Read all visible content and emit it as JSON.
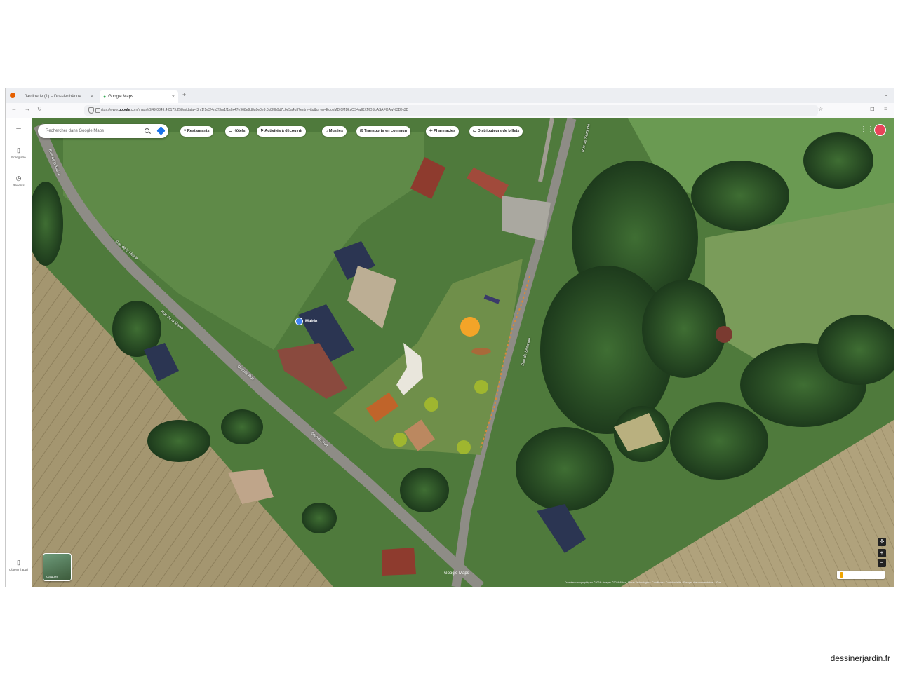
{
  "browser": {
    "tabs": [
      {
        "label": "Jardinerie (1) – Dossierthèque"
      },
      {
        "label": "Google Maps"
      }
    ],
    "url_prefix": "https://www.",
    "url_host": "google",
    "url_rest": ".com/maps/@49.0349,4.0179,258m/data=!3m1!1e3!4m2!3m1!1s0x47e968e9d8a0e0e9:0x8f8b9d7c6e5a4b3?entry=ttu&g_ep=EgoyMDI0MDkyOS4wIKXMDSoASAFQAw%3D%3D"
  },
  "sidebar": {
    "menu_label": "",
    "saved_label": "Enregistré",
    "recent_label": "Récents",
    "app_label": "Obtenir l'appli"
  },
  "search": {
    "placeholder": "Rechercher dans Google Maps"
  },
  "chips": [
    {
      "label": "Restaurants"
    },
    {
      "label": "Hôtels"
    },
    {
      "label": "Activités à découvrir"
    },
    {
      "label": "Musées"
    },
    {
      "label": "Transports en commun"
    },
    {
      "label": "Pharmacies"
    },
    {
      "label": "Distributeurs de billets"
    }
  ],
  "map": {
    "pin_label": "Mairie",
    "layers_label": "Calques",
    "watermark": "Google Maps",
    "attribution": "Données cartographiques ©2024 · Images ©2024 Airbus, Maxar Technologies · Conditions · Confidentialité · Envoyer des commentaires · 20 m",
    "road_labels": [
      "Rue de la Mairie",
      "Rue de la Mairie",
      "Rue de la Mairie",
      "Grande Rue",
      "Grande Rue",
      "Rue de Sézanne",
      "Rue de Sézanne"
    ]
  },
  "colors": {
    "pin": "#4285f4",
    "avatar": "#e9445a",
    "pegman": "#f0a500"
  },
  "credit": "dessinerjardin.fr"
}
